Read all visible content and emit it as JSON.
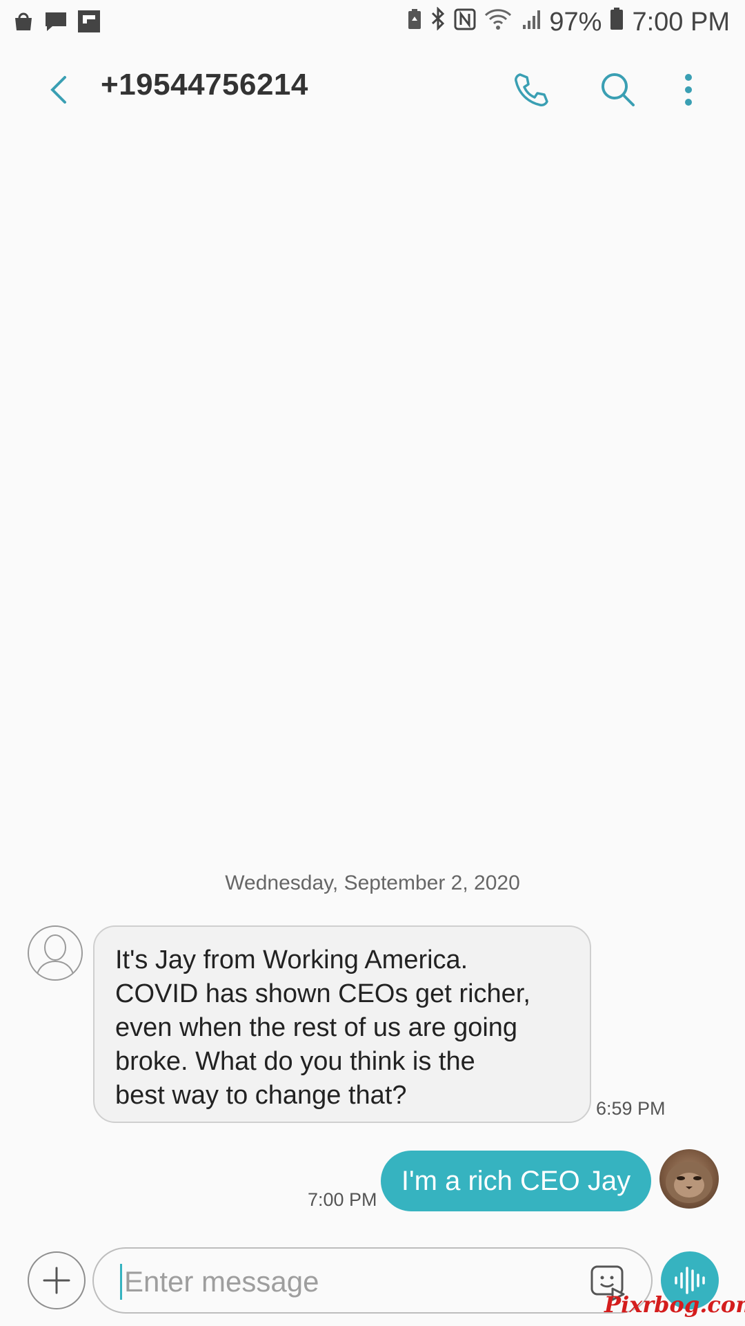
{
  "status_bar": {
    "battery": "97%",
    "time": "7:00 PM",
    "left_icons": [
      "shopping-bag-icon",
      "chat-bubble-icon",
      "flipboard-icon"
    ],
    "right_icons": [
      "battery-saver-icon",
      "bluetooth-icon",
      "nfc-icon",
      "wifi-icon",
      "signal-icon",
      "battery-icon"
    ]
  },
  "header": {
    "title": "+19544756214",
    "actions": [
      "phone-icon",
      "search-icon",
      "more-vert-icon"
    ]
  },
  "conversation": {
    "date": "Wednesday, September 2, 2020",
    "messages": [
      {
        "direction": "incoming",
        "lines": [
          "It's Jay from Working America.",
          "COVID has shown CEOs get richer,",
          "even when the rest of us are going",
          "broke. What do you think is the",
          "best way to change that?"
        ],
        "time": "6:59 PM"
      },
      {
        "direction": "outgoing",
        "text": "I'm a rich CEO Jay",
        "time": "7:00 PM"
      }
    ]
  },
  "input": {
    "placeholder": "Enter message"
  },
  "watermark": "Pixrbog.com",
  "colors": {
    "accent": "#36b3c0",
    "background": "#fafafa",
    "incoming_bubble": "#f2f2f2"
  }
}
